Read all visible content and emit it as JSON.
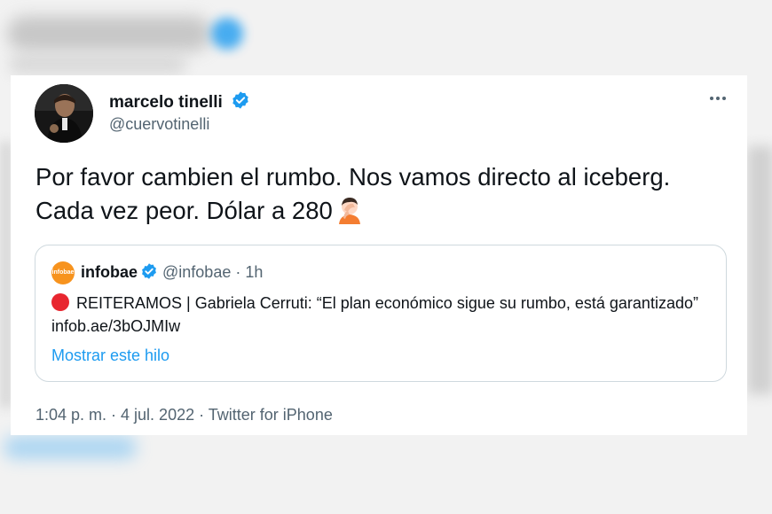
{
  "author": {
    "display_name": "marcelo tinelli",
    "handle": "@cuervotinelli"
  },
  "tweet": {
    "text": "Por favor cambien el rumbo. Nos vamos directo al iceberg. Cada vez peor. Dólar a 280",
    "emoji": "facepalm-emoji"
  },
  "quoted": {
    "logo_text": "infobae",
    "name": "infobae",
    "handle": "@infobae",
    "separator": "·",
    "time": "1h",
    "text": "REITERAMOS | Gabriela Cerruti: “El plan económico sigue su rumbo, está garantizado” infob.ae/3bOJMIw",
    "show_thread": "Mostrar este hilo"
  },
  "meta": "1:04 p. m. · 4 jul. 2022 · Twitter for iPhone",
  "colors": {
    "accent": "#1d9bf0",
    "text": "#0f1419",
    "secondary": "#536471",
    "border": "#cfd9de",
    "infobae": "#f7931e",
    "red_circle": "#e8262f"
  }
}
